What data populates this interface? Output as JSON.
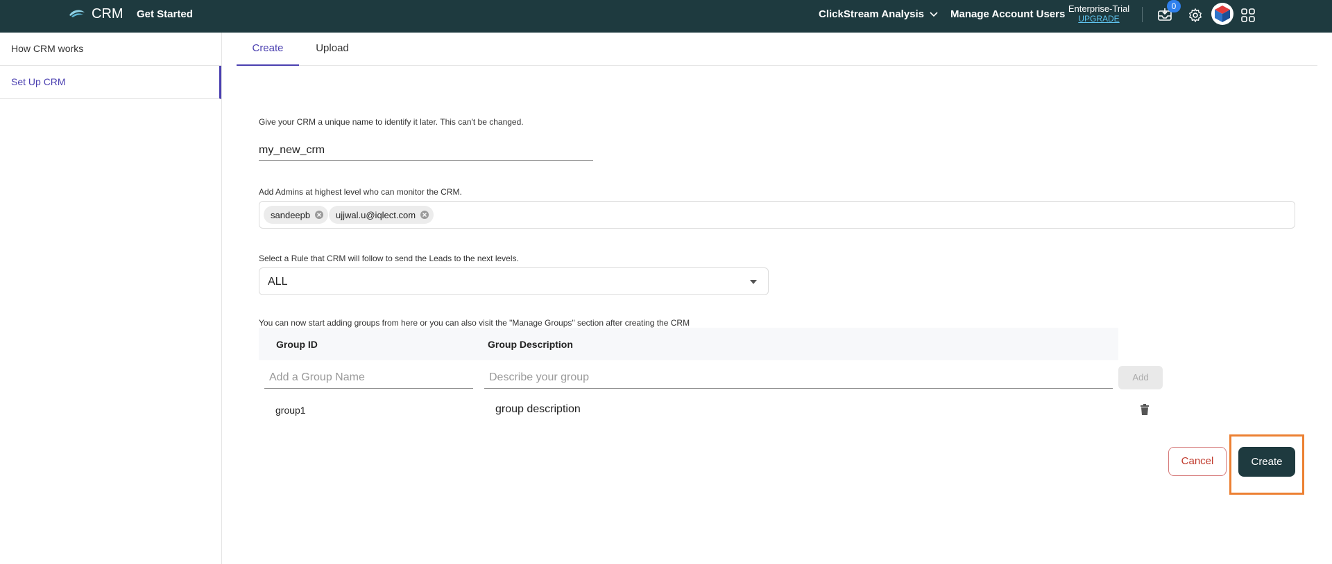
{
  "topbar": {
    "app_title": "CRM",
    "get_started": "Get Started",
    "project_name": "ClickStream Analysis",
    "manage_users": "Manage Account Users",
    "plan_name": "Enterprise-Trial",
    "upgrade_label": "UPGRADE",
    "notification_count": "0",
    "colors": {
      "background": "#1e3a3f",
      "upgrade_link": "#5fc4ef",
      "badge": "#2f80ed"
    }
  },
  "sidebar": {
    "items": [
      {
        "label": "How CRM works",
        "active": false
      },
      {
        "label": "Set Up CRM",
        "active": true
      }
    ],
    "accent_color": "#4a3fb0"
  },
  "tabs": [
    {
      "label": "Create",
      "active": true
    },
    {
      "label": "Upload",
      "active": false
    }
  ],
  "form": {
    "name_label": "Give your CRM a unique name to identify it later. This can't be changed.",
    "name_value": "my_new_crm",
    "admins_label": "Add Admins at highest level who can monitor the CRM.",
    "admins": [
      "sandeepb",
      "ujjwal.u@iqlect.com"
    ],
    "rule_label": "Select a Rule that CRM will follow to send the Leads to the next levels.",
    "rule_value": "ALL",
    "groups_label": "You can now start adding groups from here or you can also visit the \"Manage Groups\" section after creating the CRM",
    "groups_table": {
      "columns": [
        "Group ID",
        "Group Description"
      ],
      "name_placeholder": "Add a Group Name",
      "desc_placeholder": "Describe your group",
      "add_label": "Add",
      "rows": [
        {
          "id": "group1",
          "description": "group description"
        }
      ]
    }
  },
  "actions": {
    "cancel_label": "Cancel",
    "create_label": "Create",
    "create_color": "#1e3a3f",
    "highlight_color": "#ec8032"
  }
}
